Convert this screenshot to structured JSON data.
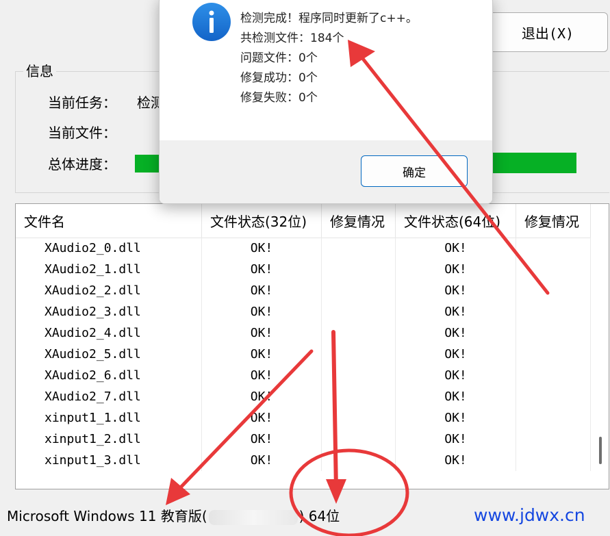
{
  "exit_button": "退出(X)",
  "info": {
    "group_title": "信息",
    "task_label": "当前任务：",
    "task_value": "检测",
    "file_label": "当前文件：",
    "progress_label": "总体进度：",
    "progress_fraction": 1.0
  },
  "table": {
    "headers": [
      "文件名",
      "文件状态(32位)",
      "修复情况",
      "文件状态(64位)",
      "修复情况"
    ],
    "rows": [
      {
        "name": "XAudio2_0.dll",
        "s32": "OK!",
        "f32": "",
        "s64": "OK!",
        "f64": ""
      },
      {
        "name": "XAudio2_1.dll",
        "s32": "OK!",
        "f32": "",
        "s64": "OK!",
        "f64": ""
      },
      {
        "name": "XAudio2_2.dll",
        "s32": "OK!",
        "f32": "",
        "s64": "OK!",
        "f64": ""
      },
      {
        "name": "XAudio2_3.dll",
        "s32": "OK!",
        "f32": "",
        "s64": "OK!",
        "f64": ""
      },
      {
        "name": "XAudio2_4.dll",
        "s32": "OK!",
        "f32": "",
        "s64": "OK!",
        "f64": ""
      },
      {
        "name": "XAudio2_5.dll",
        "s32": "OK!",
        "f32": "",
        "s64": "OK!",
        "f64": ""
      },
      {
        "name": "XAudio2_6.dll",
        "s32": "OK!",
        "f32": "",
        "s64": "OK!",
        "f64": ""
      },
      {
        "name": "XAudio2_7.dll",
        "s32": "OK!",
        "f32": "",
        "s64": "OK!",
        "f64": ""
      },
      {
        "name": "xinput1_1.dll",
        "s32": "OK!",
        "f32": "",
        "s64": "OK!",
        "f64": ""
      },
      {
        "name": "xinput1_2.dll",
        "s32": "OK!",
        "f32": "",
        "s64": "OK!",
        "f64": ""
      },
      {
        "name": "xinput1_3.dll",
        "s32": "OK!",
        "f32": "",
        "s64": "OK!",
        "f64": ""
      }
    ]
  },
  "status": {
    "os_prefix": "Microsoft Windows 11 教育版(",
    "os_suffix": ") 64位"
  },
  "watermark": "www.jdwx.cn",
  "dialog": {
    "icon": "info-icon",
    "lines": [
      "检测完成！程序同时更新了c++。",
      "共检测文件：184个",
      "问题文件：0个",
      "修复成功：0个",
      "修复失败：0个"
    ],
    "ok_label": "确定"
  },
  "colors": {
    "progress": "#06b025",
    "annotation": "#e8393a",
    "accent": "#0067c0",
    "watermark": "#1547e0"
  }
}
